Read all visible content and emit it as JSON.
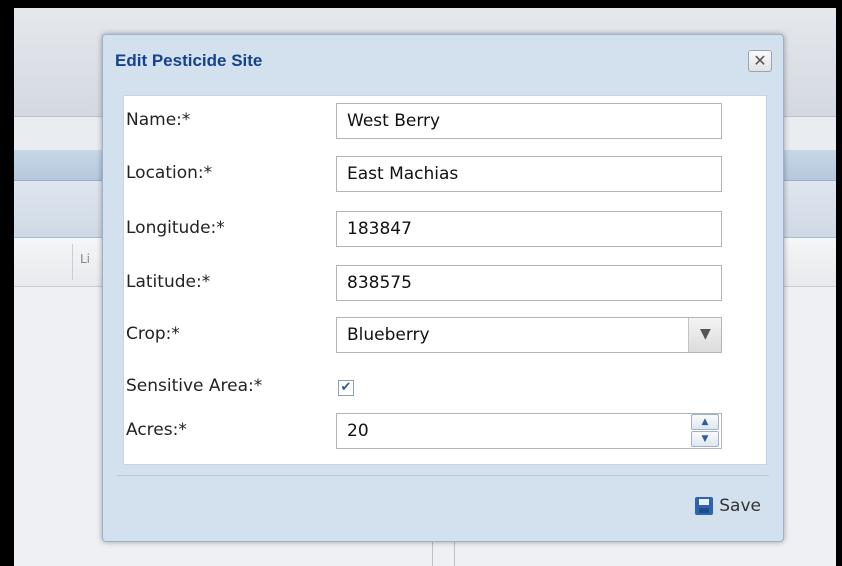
{
  "background": {
    "column_label": "Li"
  },
  "dialog": {
    "title": "Edit Pesticide Site",
    "close_glyph": "✕",
    "fields": {
      "name": {
        "label": "Name:*",
        "value": "West Berry"
      },
      "location": {
        "label": "Location:*",
        "value": "East Machias"
      },
      "longitude": {
        "label": "Longitude:*",
        "value": "183847"
      },
      "latitude": {
        "label": "Latitude:*",
        "value": "838575"
      },
      "crop": {
        "label": "Crop:*",
        "value": "Blueberry"
      },
      "sensitive_area": {
        "label": "Sensitive Area:*",
        "checked": true
      },
      "acres": {
        "label": "Acres:*",
        "value": "20"
      }
    },
    "save_label": "Save"
  },
  "icons": {
    "close": "close-icon",
    "combo": "chevron-down-icon",
    "spin_up": "chevron-up-icon",
    "spin_down": "chevron-down-icon",
    "save": "floppy-disk-icon",
    "check": "checkmark-icon"
  },
  "colors": {
    "title": "#15428b",
    "dialog_frame": "#d3e0ee",
    "check": "#2a5aa8"
  }
}
